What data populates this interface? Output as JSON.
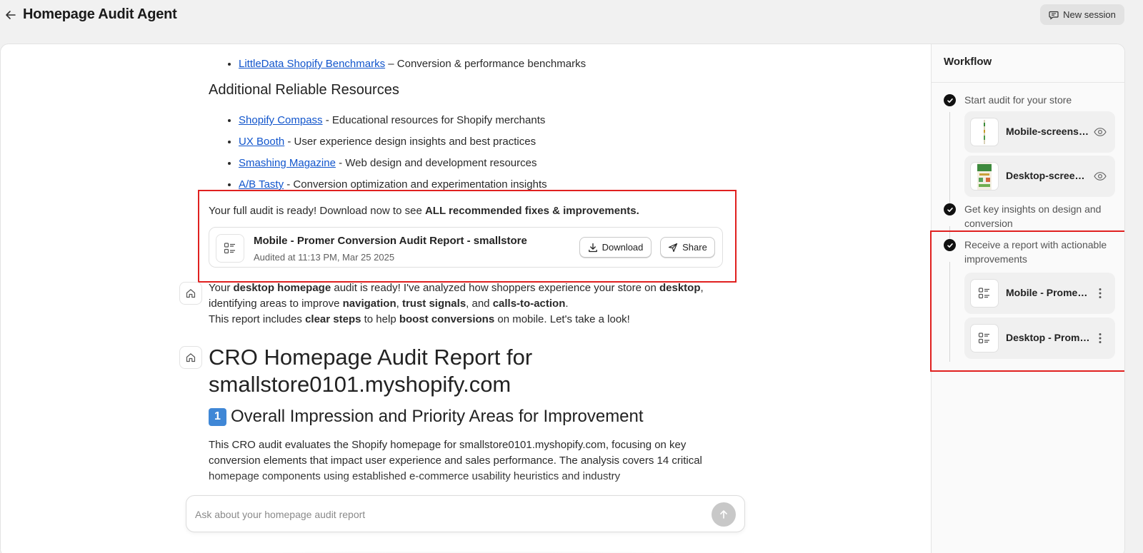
{
  "header": {
    "title": "Homepage Audit Agent",
    "new_session_label": "New session"
  },
  "chat": {
    "top_bullet": {
      "link": "LittleData Shopify Benchmarks",
      "text": " – Conversion & performance benchmarks"
    },
    "resources_heading": "Additional Reliable Resources",
    "resources": [
      {
        "link": "Shopify Compass",
        "text": " - Educational resources for Shopify merchants"
      },
      {
        "link": "UX Booth",
        "text": " - User experience design insights and best practices"
      },
      {
        "link": "Smashing Magazine",
        "text": " - Web design and development resources"
      },
      {
        "link": "A/B Tasty",
        "text": " - Conversion optimization and experimentation insights"
      }
    ],
    "audit_ready": {
      "prefix": "Your full audit is ready! Download now to see ",
      "bold": "ALL recommended fixes & improvements."
    },
    "report_card": {
      "title": "Mobile - Promer Conversion Audit Report - smallstore",
      "subtitle": "Audited at 11:13 PM, Mar 25 2025",
      "download_label": "Download",
      "share_label": "Share"
    },
    "message": {
      "line1": [
        "Your ",
        "desktop homepage",
        " audit is ready! I've analyzed how shoppers experience your store on ",
        "desktop",
        ","
      ],
      "line2": [
        "identifying areas to improve ",
        "navigation",
        ", ",
        "trust signals",
        ", and ",
        "calls-to-action",
        "."
      ],
      "line3": [
        "This report includes ",
        "clear steps",
        " to help ",
        "boost conversions",
        " on mobile. Let's take a look!"
      ]
    },
    "report_heading": "CRO Homepage Audit Report for smallstore0101.myshopify.com",
    "section_heading": {
      "number": "1",
      "text": "Overall Impression and Priority Areas for Improvement"
    },
    "intro_paragraph": "This CRO audit evaluates the Shopify homepage for smallstore0101.myshopify.com, focusing on key conversion elements that impact user experience and sales performance. The analysis covers 14 critical homepage components using established e-commerce usability heuristics and industry",
    "input_placeholder": "Ask about your homepage audit report"
  },
  "workflow": {
    "title": "Workflow",
    "steps": [
      {
        "label": "Start audit for your store"
      },
      {
        "label": "Get key insights on design and conversion"
      },
      {
        "label": "Receive a report with actionable improvements"
      }
    ],
    "screenshots": [
      {
        "name": "Mobile-screenshot"
      },
      {
        "name": "Desktop-screenshot"
      }
    ],
    "reports": [
      {
        "name": "Mobile - Promer Conversion Audit Report"
      },
      {
        "name": "Desktop - Promer Conversion Audit Report"
      }
    ]
  },
  "colors": {
    "highlight": "#e0201f",
    "link": "#1155cc",
    "keycap": "#3f87d6"
  }
}
